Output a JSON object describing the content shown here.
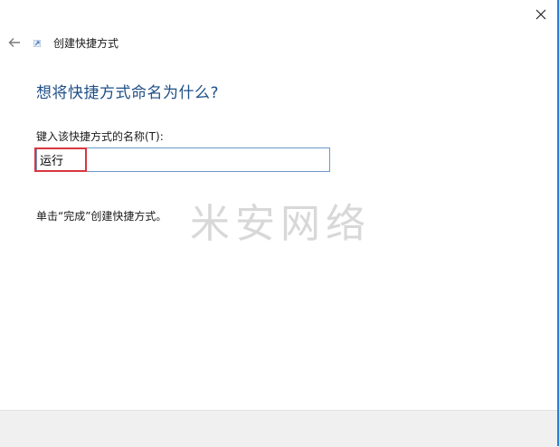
{
  "window": {
    "title": "创建快捷方式",
    "close_icon": "close-icon",
    "back_icon": "back-arrow-icon"
  },
  "main": {
    "heading": "想将快捷方式命名为什么?",
    "field_label": "键入该快捷方式的名称(T):",
    "input_value": "运行",
    "hint": "单击“完成”创建快捷方式。"
  },
  "watermark": "米安网络",
  "colors": {
    "heading": "#1e4f87",
    "input_border": "#6a98c8",
    "highlight": "#d9363e",
    "accent_edge": "#2d7fd6"
  }
}
